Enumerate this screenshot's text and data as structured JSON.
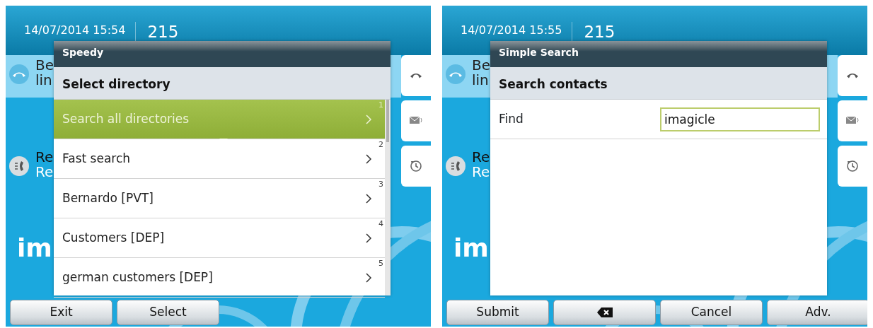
{
  "screens": [
    {
      "datetime": "14/07/2014 15:54",
      "extension": "215",
      "behind_items": [
        {
          "kind": "call",
          "line_1": "Be",
          "line_2": "lin"
        },
        {
          "kind": "recent",
          "line_1": "Re",
          "line_2": "Re"
        }
      ],
      "logo_fragment": "im",
      "side_keys": [
        {
          "kind": "handset"
        },
        {
          "kind": "envelope"
        },
        {
          "kind": "history"
        }
      ],
      "dialog": {
        "title": "Speedy",
        "heading": "Select directory",
        "kind": "list",
        "items": [
          {
            "number": "1",
            "label": "Search all directories",
            "selected": true
          },
          {
            "number": "2",
            "label": "Fast search",
            "selected": false
          },
          {
            "number": "3",
            "label": "Bernardo [PVT]",
            "selected": false
          },
          {
            "number": "4",
            "label": "Customers [DEP]",
            "selected": false
          },
          {
            "number": "5",
            "label": "german customers [DEP]",
            "selected": false
          }
        ]
      },
      "softkeys": [
        {
          "kind": "text",
          "label": "Exit"
        },
        {
          "kind": "text",
          "label": "Select"
        }
      ]
    },
    {
      "datetime": "14/07/2014 15:55",
      "extension": "215",
      "behind_items": [
        {
          "kind": "call",
          "line_1": "Be",
          "line_2": "lin"
        },
        {
          "kind": "recent",
          "line_1": "Re",
          "line_2": "Re"
        }
      ],
      "logo_fragment": "im",
      "side_keys": [
        {
          "kind": "handset"
        },
        {
          "kind": "envelope"
        },
        {
          "kind": "history"
        }
      ],
      "dialog": {
        "title": "Simple Search",
        "heading": "Search contacts",
        "kind": "form",
        "fields": [
          {
            "label": "Find",
            "value": "imagicle"
          }
        ]
      },
      "softkeys": [
        {
          "kind": "text",
          "label": "Submit"
        },
        {
          "kind": "backspace"
        },
        {
          "kind": "text",
          "label": "Cancel"
        },
        {
          "kind": "text",
          "label": "Adv."
        }
      ]
    }
  ]
}
